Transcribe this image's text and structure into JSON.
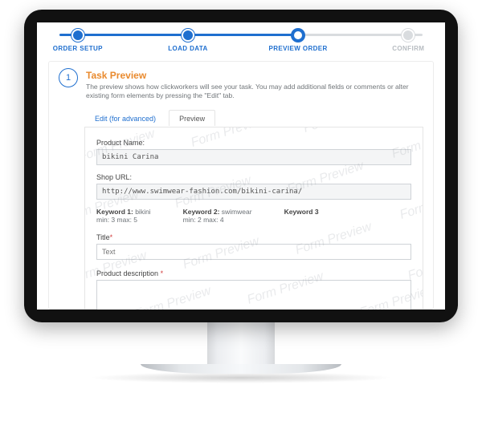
{
  "stepper": {
    "steps": [
      {
        "label": "ORDER SETUP",
        "state": "done"
      },
      {
        "label": "LOAD DATA",
        "state": "done"
      },
      {
        "label": "PREVIEW ORDER",
        "state": "current"
      },
      {
        "label": "CONFIRM",
        "state": "disabled"
      }
    ]
  },
  "card": {
    "number": "1",
    "title": "Task Preview",
    "subtitle": "The preview shows how clickworkers will see your task. You may add additional fields or comments or alter existing form elements by pressing the \"Edit\" tab."
  },
  "tabs": {
    "edit": "Edit (for advanced)",
    "preview": "Preview"
  },
  "form": {
    "product_name_label": "Product Name:",
    "product_name_value": "bikini Carina",
    "shop_url_label": "Shop URL:",
    "shop_url_value": "http://www.swimwear-fashion.com/bikini-carina/",
    "k1_label": "Keyword 1:",
    "k1_value": "bikini",
    "k1_rule": "min: 3   max: 5",
    "k2_label": "Keyword 2:",
    "k2_value": "swimwear",
    "k2_rule": "min: 2   max: 4",
    "k3_label": "Keyword 3",
    "title_label": "Title",
    "title_placeholder": "Text",
    "desc_label": "Product description"
  },
  "watermark": "Form Preview"
}
